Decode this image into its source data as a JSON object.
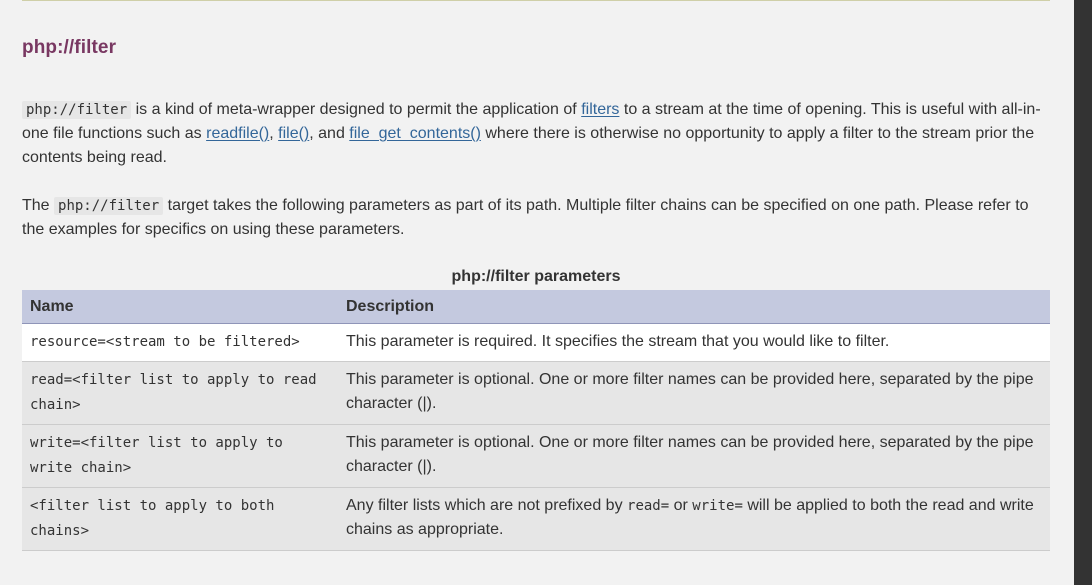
{
  "section": {
    "title": "php://filter"
  },
  "para1": {
    "code": "php://filter",
    "text_a": " is a kind of meta-wrapper designed to permit the application of ",
    "link_filters": "filters",
    "text_b": " to a stream at the time of opening. This is useful with all-in-one file functions such as ",
    "link_readfile": "readfile()",
    "sep1": ", ",
    "link_file": "file()",
    "sep2": ", and ",
    "link_fgc": "file_get_contents()",
    "text_c": " where there is otherwise no opportunity to apply a filter to the stream prior the contents being read."
  },
  "para2": {
    "text_a": "The ",
    "code": "php://filter",
    "text_b": " target takes the following parameters as part of its path. Multiple filter chains can be specified on one path. Please refer to the examples for specifics on using these parameters."
  },
  "table": {
    "caption": "php://filter parameters",
    "headers": [
      "Name",
      "Description"
    ],
    "rows": [
      {
        "name": "resource=<stream to be filtered>",
        "desc": "This parameter is required. It specifies the stream that you would like to filter."
      },
      {
        "name": "read=<filter list to apply to read chain>",
        "desc": "This parameter is optional. One or more filter names can be provided here, separated by the pipe character (|)."
      },
      {
        "name": "write=<filter list to apply to write chain>",
        "desc": "This parameter is optional. One or more filter names can be provided here, separated by the pipe character (|)."
      },
      {
        "name": "<filter list to apply to both chains>",
        "desc_a": "Any filter lists which are not prefixed by ",
        "desc_code1": "read=",
        "desc_b": " or ",
        "desc_code2": "write=",
        "desc_c": " will be applied to both the read and write chains as appropriate."
      }
    ]
  },
  "colors": {
    "title": "#793862",
    "link": "#336699",
    "header_bg": "#c4c9df",
    "row_alt_bg": "#e6e6e6",
    "page_bg": "#f2f2f2",
    "scrollbar": "#333333"
  }
}
